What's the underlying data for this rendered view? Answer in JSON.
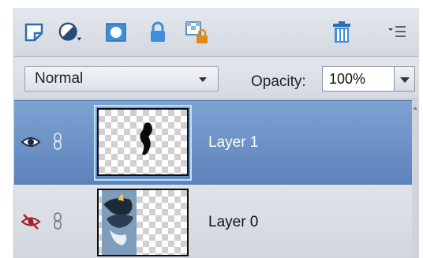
{
  "toolbar": {
    "icons": [
      "new-layer-icon",
      "adjustment-layer-icon",
      "layer-mask-icon",
      "lock-all-icon",
      "lock-transparent-icon",
      "delete-layer-icon",
      "panel-menu-icon"
    ]
  },
  "blend": {
    "mode": "Normal",
    "opacity_label": "Opacity:",
    "opacity_value": "100%"
  },
  "layers": [
    {
      "name": "Layer 1",
      "visible": true,
      "selected": true
    },
    {
      "name": "Layer 0",
      "visible": false,
      "selected": false
    }
  ],
  "colors": {
    "selection": "#6a8fc4",
    "toolbar_icon_blue": "#3f8ed8",
    "lock_orange": "#e08a18"
  }
}
